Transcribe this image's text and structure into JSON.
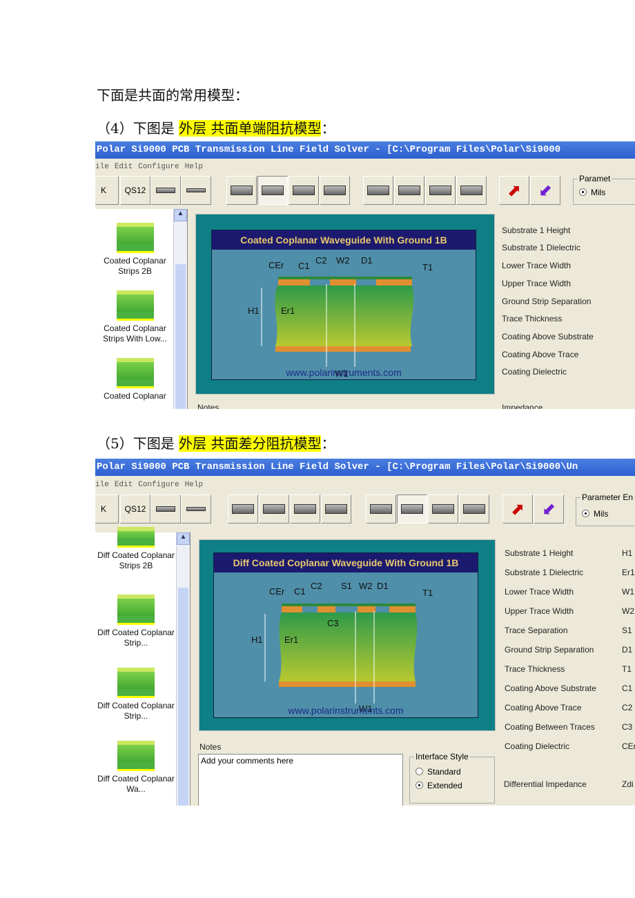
{
  "heading": "下面是共面的常用模型：",
  "fig4": {
    "prefix": "（4）下图是 ",
    "highlight": "外层 共面单端阻抗模型",
    "suffix": "：",
    "window_title": "Polar Si9000 PCB Transmission Line Field Solver - [C:\\Program Files\\Polar\\Si9000",
    "menu": [
      "ile",
      "Edit",
      "Configure",
      "Help"
    ],
    "toolbar_labels": [
      "K",
      "QS12"
    ],
    "group_label": "Paramet",
    "units": "Mils",
    "list_items": [
      "Coated Coplanar Strips 2B",
      "Coated Coplanar Strips With Low...",
      "Coated Coplanar"
    ],
    "diagram_title": "Coated Coplanar Waveguide With Ground 1B",
    "diagram_url": "www.polarinstruments.com",
    "labels": {
      "cer": "CEr",
      "c1": "C1",
      "c2": "C2",
      "w2": "W2",
      "d1": "D1",
      "t1": "T1",
      "h1": "H1",
      "er1": "Er1",
      "w1": "W1"
    },
    "params": [
      "Substrate 1 Height",
      "Substrate 1 Dielectric",
      "Lower Trace Width",
      "Upper Trace Width",
      "Ground Strip Separation",
      "Trace Thickness",
      "Coating Above Substrate",
      "Coating Above Trace",
      "Coating Dielectric"
    ],
    "notes_label": "Notes",
    "impedance_label": "Impedance"
  },
  "fig5": {
    "prefix": "（5）下图是 ",
    "highlight": "外层 共面差分阻抗模型",
    "suffix": "：",
    "window_title": "Polar Si9000 PCB Transmission Line Field Solver - [C:\\Program Files\\Polar\\Si9000\\Un",
    "menu": [
      "ile",
      "Edit",
      "Configure",
      "Help"
    ],
    "toolbar_labels": [
      "K",
      "QS12"
    ],
    "group_label": "Parameter En",
    "units": "Mils",
    "list_items": [
      "Diff Coated Coplanar Strips 2B",
      "Diff Coated Coplanar Strip...",
      "Diff Coated Coplanar Strip...",
      "Diff Coated Coplanar Wa..."
    ],
    "diagram_title": "Diff Coated Coplanar Waveguide With Ground 1B",
    "diagram_url": "www.polarinstruments.com",
    "labels": {
      "cer": "CEr",
      "c1": "C1",
      "c2": "C2",
      "s1": "S1",
      "w2": "W2",
      "d1": "D1",
      "t1": "T1",
      "c3": "C3",
      "h1": "H1",
      "er1": "Er1",
      "w1": "W1"
    },
    "params": [
      {
        "name": "Substrate 1 Height",
        "sym": "H1"
      },
      {
        "name": "Substrate 1 Dielectric",
        "sym": "Er1"
      },
      {
        "name": "Lower Trace Width",
        "sym": "W1"
      },
      {
        "name": "Upper Trace Width",
        "sym": "W2"
      },
      {
        "name": "Trace Separation",
        "sym": "S1"
      },
      {
        "name": "Ground Strip Separation",
        "sym": "D1"
      },
      {
        "name": "Trace Thickness",
        "sym": "T1"
      },
      {
        "name": "Coating Above Substrate",
        "sym": "C1"
      },
      {
        "name": "Coating Above Trace",
        "sym": "C2"
      },
      {
        "name": "Coating Between Traces",
        "sym": "C3"
      },
      {
        "name": "Coating Dielectric",
        "sym": "CEr"
      }
    ],
    "impedance": {
      "name": "Differential Impedance",
      "sym": "Zdi"
    },
    "notes_label": "Notes",
    "notes_value": "Add your comments here",
    "interface_style": {
      "label": "Interface Style",
      "options": [
        "Standard",
        "Extended"
      ],
      "selected": "Extended"
    }
  }
}
